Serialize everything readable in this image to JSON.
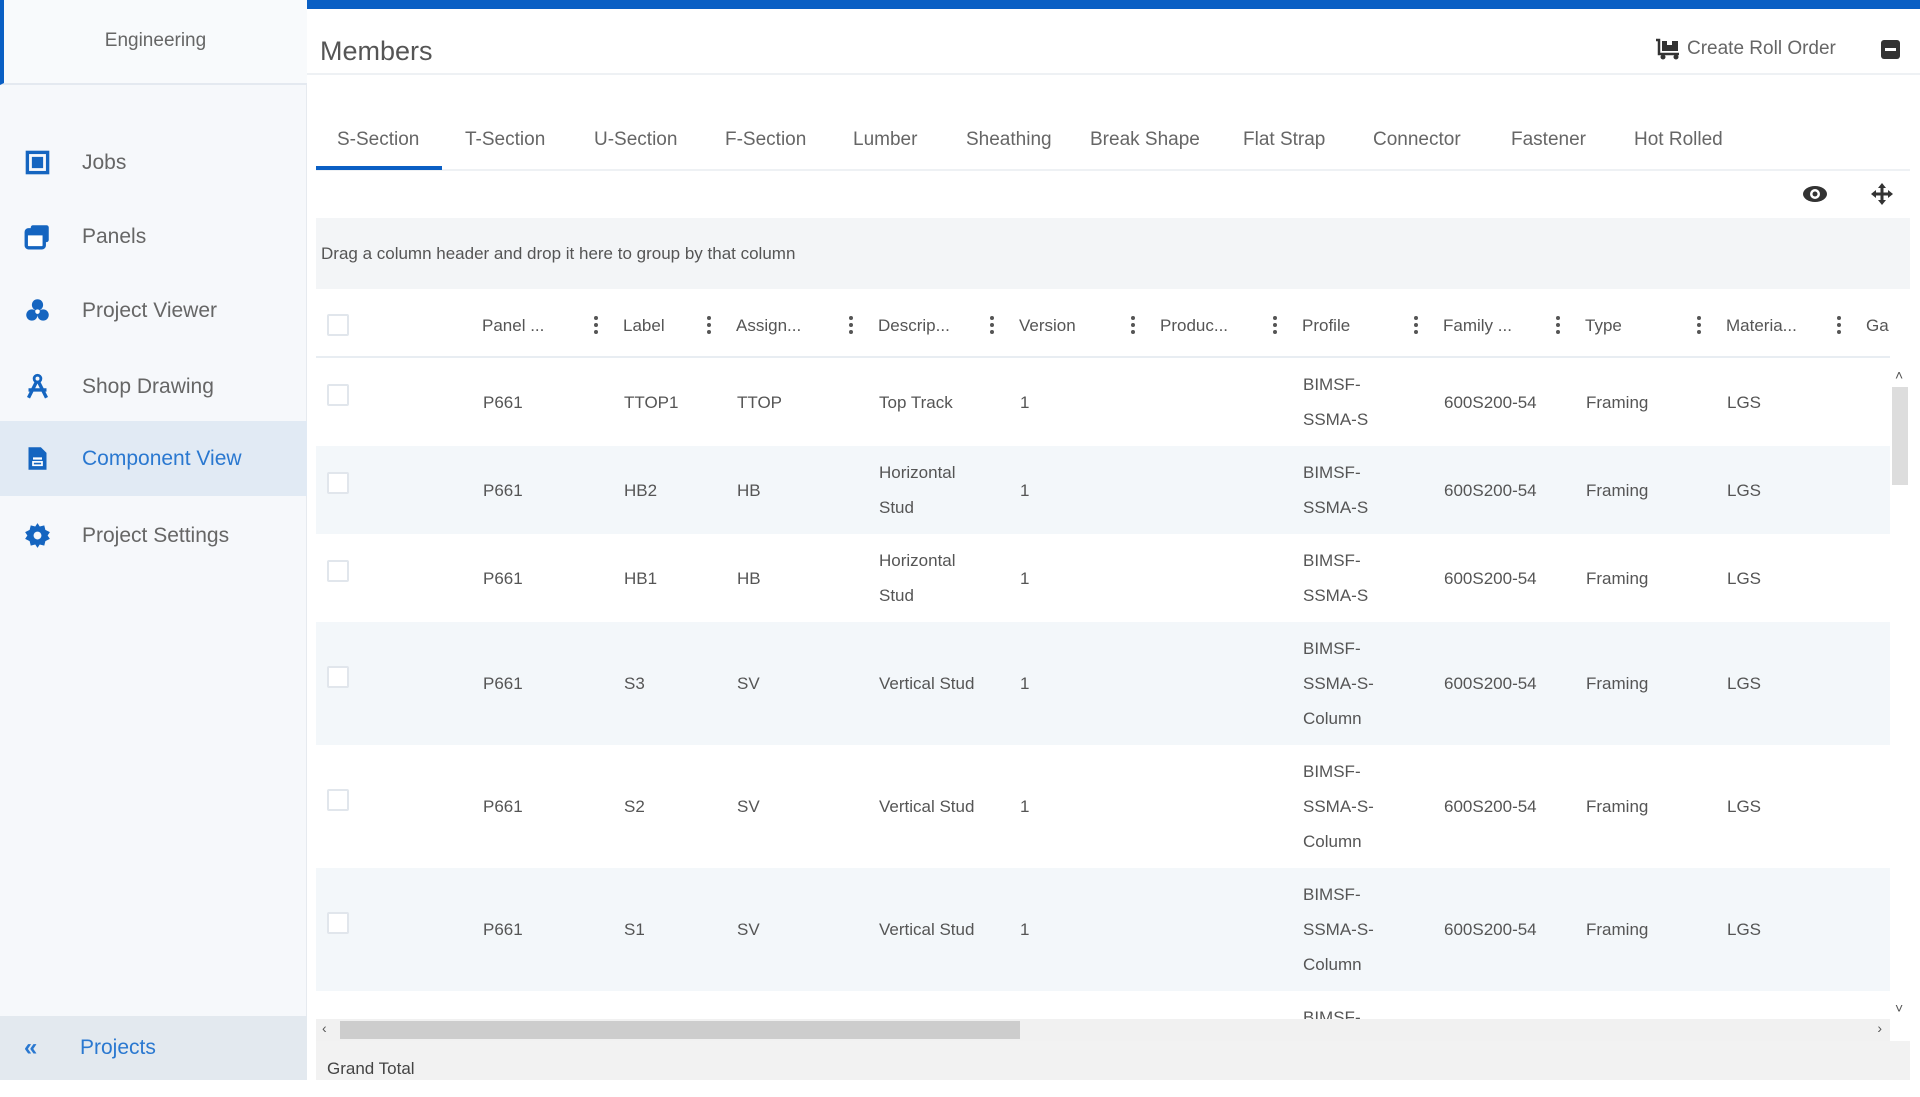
{
  "sidebar": {
    "brand": "Engineering",
    "items": [
      {
        "label": "Jobs",
        "icon": "jobs-icon"
      },
      {
        "label": "Panels",
        "icon": "panels-icon"
      },
      {
        "label": "Project Viewer",
        "icon": "project-viewer-icon"
      },
      {
        "label": "Shop Drawing",
        "icon": "shop-drawing-icon"
      },
      {
        "label": "Component View",
        "icon": "component-view-icon",
        "active": true
      },
      {
        "label": "Project Settings",
        "icon": "gear-icon"
      }
    ],
    "footer": {
      "label": "Projects",
      "icon": "chevron-double-left-icon"
    }
  },
  "header": {
    "title": "Members",
    "create_roll_order": "Create Roll Order"
  },
  "tabs": [
    "S-Section",
    "T-Section",
    "U-Section",
    "F-Section",
    "Lumber",
    "Sheathing",
    "Break Shape",
    "Flat Strap",
    "Connector",
    "Fastener",
    "Hot Rolled"
  ],
  "active_tab": "S-Section",
  "group_panel": "Drag a column header and drop it here to group by that column",
  "columns": [
    "Panel ...",
    "Label",
    "Assign...",
    "Descrip...",
    "Version",
    "Produc...",
    "Profile",
    "Family ...",
    "Type",
    "Materia...",
    "Ga"
  ],
  "rows": [
    [
      "P661",
      "TTOP1",
      "TTOP",
      "Top Track",
      "1",
      "",
      "BIMSF-SSMA-S",
      "600S200-54",
      "Framing",
      "LGS",
      ""
    ],
    [
      "P661",
      "HB2",
      "HB",
      "Horizontal Stud",
      "1",
      "",
      "BIMSF-SSMA-S",
      "600S200-54",
      "Framing",
      "LGS",
      ""
    ],
    [
      "P661",
      "HB1",
      "HB",
      "Horizontal Stud",
      "1",
      "",
      "BIMSF-SSMA-S",
      "600S200-54",
      "Framing",
      "LGS",
      ""
    ],
    [
      "P661",
      "S3",
      "SV",
      "Vertical Stud",
      "1",
      "",
      "BIMSF-SSMA-S-Column",
      "600S200-54",
      "Framing",
      "LGS",
      ""
    ],
    [
      "P661",
      "S2",
      "SV",
      "Vertical Stud",
      "1",
      "",
      "BIMSF-SSMA-S-Column",
      "600S200-54",
      "Framing",
      "LGS",
      ""
    ],
    [
      "P661",
      "S1",
      "SV",
      "Vertical Stud",
      "1",
      "",
      "BIMSF-SSMA-S-Column",
      "600S200-54",
      "Framing",
      "LGS",
      ""
    ],
    [
      "",
      "",
      "",
      "",
      "",
      "",
      "BIMSF-",
      "",
      "",
      "",
      ""
    ]
  ],
  "footer_row": {
    "label": "Grand Total"
  },
  "colors": {
    "accent": "#0a5fc4",
    "active_nav_bg": "#e1eaf4",
    "active_nav_text": "#2a78d0"
  }
}
